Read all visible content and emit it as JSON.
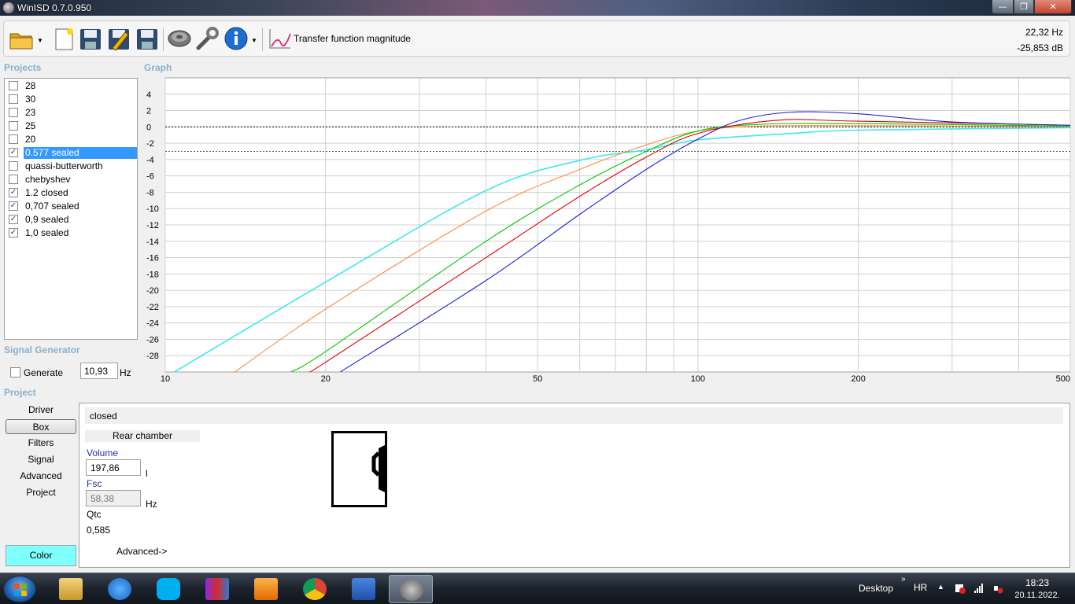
{
  "window": {
    "title": "WinISD 0.7.0.950",
    "min": "—",
    "max": "❐",
    "close": "✕"
  },
  "toolbar": {
    "icons": [
      "open-folder-icon",
      "new-project-icon",
      "save-icon",
      "edit-save-icon",
      "save-all-icon",
      "driver-icon",
      "tools-wrench-icon",
      "info-icon",
      "graph-icon"
    ],
    "graph_label": "Transfer function magnitude",
    "readout_hz": "22,32 Hz",
    "readout_db": "-25,853 dB"
  },
  "sections": {
    "projects": "Projects",
    "graph": "Graph",
    "signal_generator": "Signal Generator",
    "project": "Project"
  },
  "projects": [
    {
      "label": "28",
      "checked": false,
      "selected": false
    },
    {
      "label": "30",
      "checked": false,
      "selected": false
    },
    {
      "label": "23",
      "checked": false,
      "selected": false
    },
    {
      "label": "25",
      "checked": false,
      "selected": false
    },
    {
      "label": "20",
      "checked": false,
      "selected": false
    },
    {
      "label": "0.577 sealed",
      "checked": true,
      "selected": true
    },
    {
      "label": "quassi-butterworth",
      "checked": false,
      "selected": false
    },
    {
      "label": "chebyshev",
      "checked": false,
      "selected": false
    },
    {
      "label": "1.2 closed",
      "checked": true,
      "selected": false
    },
    {
      "label": "0,707 sealed",
      "checked": true,
      "selected": false
    },
    {
      "label": "0,9 sealed",
      "checked": true,
      "selected": false
    },
    {
      "label": "1,0 sealed",
      "checked": true,
      "selected": false
    }
  ],
  "chart_data": {
    "type": "line",
    "x_scale": "log",
    "xlim": [
      10,
      500
    ],
    "ylim": [
      -30,
      6
    ],
    "x_ticks": [
      {
        "value": 10,
        "label": "10"
      },
      {
        "value": 20,
        "label": "20"
      },
      {
        "value": 50,
        "label": "50"
      },
      {
        "value": 100,
        "label": "100"
      },
      {
        "value": 200,
        "label": "200"
      },
      {
        "value": 500,
        "label": "500"
      }
    ],
    "x_minor_grid": [
      30,
      40,
      60,
      70,
      80,
      90,
      300,
      400
    ],
    "y_ticks": [
      4,
      2,
      0,
      -2,
      -4,
      -6,
      -8,
      -10,
      -12,
      -14,
      -16,
      -18,
      -20,
      -22,
      -24,
      -26,
      -28
    ],
    "reference_lines": [
      0,
      -3
    ],
    "grid": true,
    "series": [
      {
        "color": "#3ee8f0",
        "points": [
          [
            10.4,
            -30
          ],
          [
            20,
            -19
          ],
          [
            40,
            -7.8
          ],
          [
            60,
            -4.1
          ],
          [
            80,
            -2.8
          ],
          [
            100,
            -1.6
          ],
          [
            150,
            -0.8
          ],
          [
            200,
            -0.4
          ],
          [
            500,
            -0.1
          ]
        ]
      },
      {
        "color": "#ff8c3c",
        "points": [
          [
            13.5,
            -30
          ],
          [
            20,
            -22.3
          ],
          [
            40,
            -10.3
          ],
          [
            60,
            -5.2
          ],
          [
            80,
            -2.2
          ],
          [
            100,
            -0.5
          ],
          [
            130,
            0.1
          ],
          [
            200,
            0.15
          ],
          [
            500,
            0.05
          ]
        ]
      },
      {
        "color": "#00c800",
        "points": [
          [
            17.2,
            -30
          ],
          [
            20,
            -27.5
          ],
          [
            40,
            -14
          ],
          [
            60,
            -7.1
          ],
          [
            80,
            -3
          ],
          [
            100,
            -0.5
          ],
          [
            130,
            0.3
          ],
          [
            200,
            0.4
          ],
          [
            500,
            0.1
          ]
        ]
      },
      {
        "color": "#e00000",
        "points": [
          [
            18.6,
            -30
          ],
          [
            20,
            -28.8
          ],
          [
            40,
            -16
          ],
          [
            60,
            -8.5
          ],
          [
            80,
            -3.7
          ],
          [
            100,
            -0.8
          ],
          [
            140,
            0.8
          ],
          [
            200,
            0.7
          ],
          [
            500,
            0.2
          ]
        ]
      },
      {
        "color": "#1f1fd0",
        "points": [
          [
            21.3,
            -30
          ],
          [
            40,
            -18.8
          ],
          [
            60,
            -10.7
          ],
          [
            80,
            -5.2
          ],
          [
            100,
            -1.5
          ],
          [
            120,
            0.8
          ],
          [
            150,
            1.8
          ],
          [
            200,
            1.6
          ],
          [
            300,
            0.6
          ],
          [
            500,
            0.2
          ]
        ]
      }
    ]
  },
  "signal_generator": {
    "generate_label": "Generate",
    "checked": false,
    "frequency": "10,93",
    "unit": "Hz"
  },
  "nav": [
    {
      "label": "Driver",
      "active": false
    },
    {
      "label": "Box",
      "active": true
    },
    {
      "label": "Filters",
      "active": false
    },
    {
      "label": "Signal",
      "active": false
    },
    {
      "label": "Advanced",
      "active": false
    },
    {
      "label": "Project",
      "active": false
    }
  ],
  "color_button": {
    "label": "Color",
    "color": "#80ffff"
  },
  "box": {
    "type": "closed",
    "rear_chamber": "Rear chamber",
    "volume_label": "Volume",
    "volume_value": "197,86",
    "volume_unit": "l",
    "fsc_label": "Fsc",
    "fsc_value": "58,38",
    "fsc_unit": "Hz",
    "qtc_label": "Qtc",
    "qtc_value": "0,585",
    "advanced": "Advanced->"
  },
  "taskbar": {
    "apps": [
      "explorer-icon",
      "internet-explorer-icon",
      "skype-icon",
      "winrar-icon",
      "media-player-icon",
      "chrome-icon",
      "word-icon",
      "winisd-icon"
    ],
    "desktop": "Desktop",
    "chevron": "»",
    "language": "HR",
    "tray_up": "▲",
    "time": "18:23",
    "date": "20.11.2022."
  }
}
